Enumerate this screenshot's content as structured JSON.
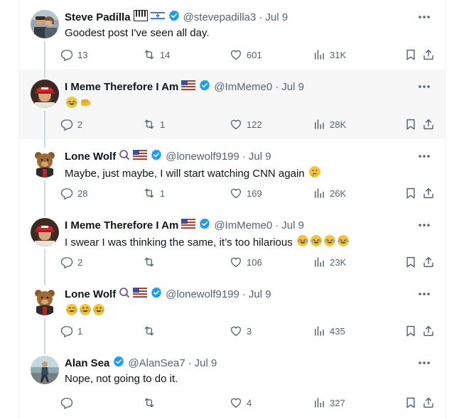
{
  "tweets": [
    {
      "name": "Steve Padilla",
      "handle": "@stevepadilla3",
      "date": "Jul 9",
      "text": "Goodest post I've seen all day.",
      "emojis": [],
      "replies": "13",
      "reposts": "14",
      "likes": "601",
      "views": "31K",
      "avatar": "couple-photo-avatar",
      "flags": [
        "piano-keys-flag",
        "israel-flag"
      ]
    },
    {
      "name": "I Meme Therefore I Am",
      "handle": "@ImMeme0",
      "date": "Jul 9",
      "text": "",
      "emojis": [
        "rolling-laughing-emoji",
        "fist-bump-emoji"
      ],
      "replies": "2",
      "reposts": "1",
      "likes": "122",
      "views": "28K",
      "avatar": "red-cap-portrait-avatar",
      "flags": [
        "us-flag"
      ]
    },
    {
      "name": "Lone Wolf",
      "handle": "@lonewolf9199",
      "date": "Jul 9",
      "text": "Maybe, just maybe, I will start watching CNN again",
      "emojis": [
        "thinking-face-emoji"
      ],
      "replies": "28",
      "reposts": "1",
      "likes": "169",
      "views": "26K",
      "avatar": "bear-avatar",
      "flags": [
        "magnifier-icon",
        "us-flag"
      ]
    },
    {
      "name": "I Meme Therefore I Am",
      "handle": "@ImMeme0",
      "date": "Jul 9",
      "text": "I swear I was thinking the same, it’s too hilarious",
      "emojis": [
        "rolling-laughing-emoji",
        "rolling-laughing-emoji",
        "rolling-laughing-emoji",
        "rolling-laughing-emoji"
      ],
      "replies": "2",
      "reposts": "",
      "likes": "106",
      "views": "23K",
      "avatar": "red-cap-portrait-avatar",
      "flags": [
        "us-flag"
      ]
    },
    {
      "name": "Lone Wolf",
      "handle": "@lonewolf9199",
      "date": "Jul 9",
      "text": "",
      "emojis": [
        "tears-of-joy-emoji",
        "tears-of-joy-emoji",
        "tears-of-joy-emoji"
      ],
      "replies": "1",
      "reposts": "",
      "likes": "3",
      "views": "435",
      "avatar": "bear-avatar",
      "flags": [
        "magnifier-icon",
        "us-flag"
      ]
    },
    {
      "name": "Alan Sea",
      "handle": "@AlanSea7",
      "date": "Jul 9",
      "text": "Nope, not going to do it.",
      "emojis": [],
      "replies": "",
      "reposts": "",
      "likes": "4",
      "views": "327",
      "avatar": "person-walking-avatar",
      "flags": []
    }
  ],
  "colors": {
    "verified": "#1d9bf0",
    "muted": "#536471",
    "thread_line": "#cfd9de",
    "highlight_bg": "#f7f7f7"
  },
  "separator": "·"
}
